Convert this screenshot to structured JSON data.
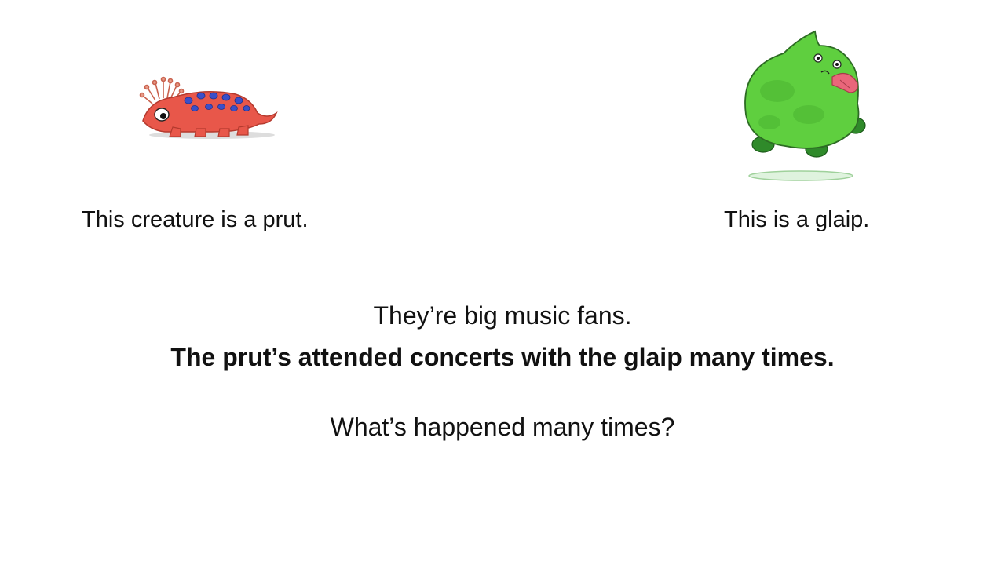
{
  "slide": {
    "prut": {
      "caption": "This creature is a prut.",
      "icon": "prut-creature-illustration",
      "colors": {
        "body": "#e8574a",
        "spots": "#3a4fc9"
      }
    },
    "glaip": {
      "caption": "This is a glaip.",
      "icon": "glaip-creature-illustration",
      "colors": {
        "body": "#5fcf3f",
        "tongue": "#e9667a",
        "feet": "#2f8a2a"
      }
    },
    "context_sentence": "They’re big music fans.",
    "target_sentence": "The prut’s attended concerts with the glaip many times.",
    "question": "What’s happened many times?"
  }
}
